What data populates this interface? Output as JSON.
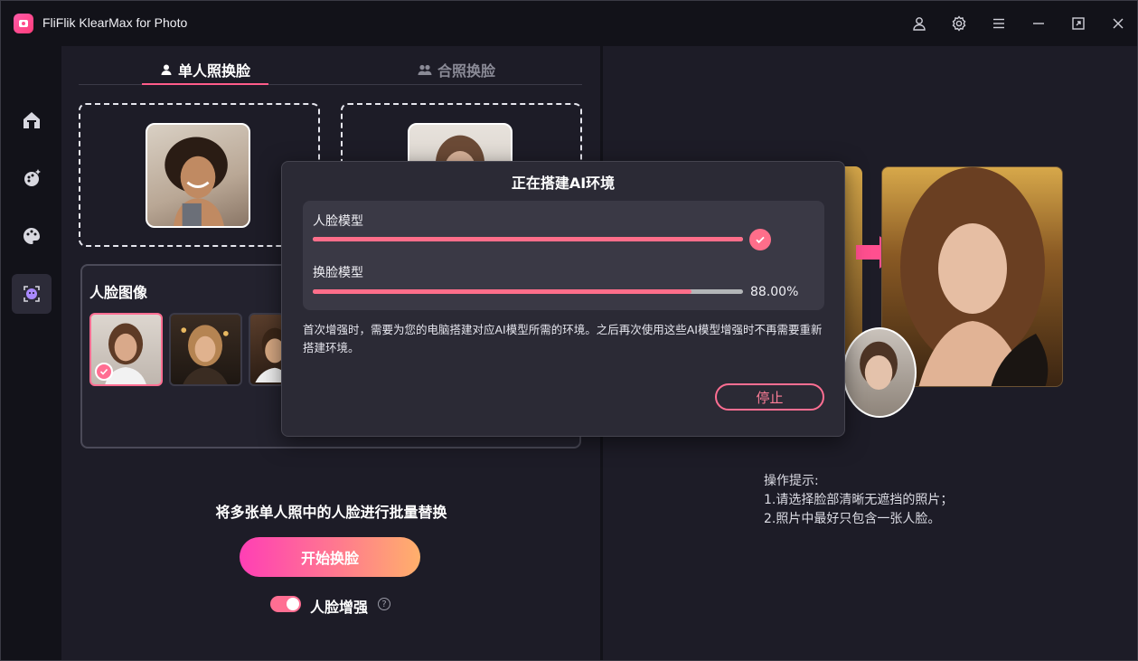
{
  "window": {
    "title": "FliFlik KlearMax for Photo"
  },
  "titlebar": {
    "icons": [
      "user-icon",
      "gear-icon",
      "menu-icon",
      "minimize-icon",
      "maximize-icon",
      "close-icon"
    ]
  },
  "sidebar": {
    "items": [
      {
        "name": "home",
        "icon": "home-icon"
      },
      {
        "name": "enhance",
        "icon": "palette-sparkle-icon"
      },
      {
        "name": "colorize",
        "icon": "palette-icon"
      },
      {
        "name": "face-swap",
        "icon": "face-swap-icon",
        "active": true
      }
    ]
  },
  "tabs": {
    "single": "单人照换脸",
    "group": "合照换脸"
  },
  "face_group": {
    "title": "人脸图像"
  },
  "batch_text": "将多张单人照中的人脸进行批量替换",
  "start_button": "开始换脸",
  "face_enhance": {
    "label": "人脸增强",
    "enabled": true,
    "help": "?"
  },
  "tips": {
    "text": "操作提示:\n1.请选择脸部清晰无遮挡的照片；\n2.照片中最好只包含一张人脸。"
  },
  "modal": {
    "title": "正在搭建AI环境",
    "items": [
      {
        "label": "人脸模型",
        "progress": 1.0,
        "done": true
      },
      {
        "label": "换脸模型",
        "progress": 0.88,
        "percent_text": "88.00%"
      }
    ],
    "description": "首次增强时，需要为您的电脑搭建对应AI模型所需的环境。之后再次使用这些AI模型增强时不再需要重新搭建环境。",
    "stop_button": "停止"
  },
  "colors": {
    "accent": "#ff6e92",
    "background": "#1d1c27",
    "sidebar": "#121219"
  }
}
